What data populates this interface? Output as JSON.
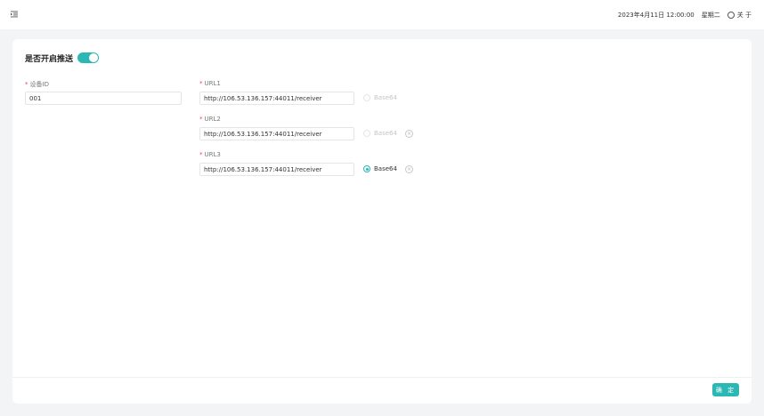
{
  "topbar": {
    "menu_icon": "menu-fold-icon",
    "datetime": "2023年4月11日 12:00:00",
    "weekday": "星期二",
    "about_label": "关 于",
    "about_icon": "info-circle-icon"
  },
  "form": {
    "title": "是否开启推送",
    "push_enabled": true,
    "device": {
      "label": "设备ID",
      "required": "*",
      "value": "001"
    },
    "urls": [
      {
        "label": "URL1",
        "required": "*",
        "value": "http://106.53.136.157:44011/receiver",
        "base64_label": "Base64",
        "base64_checked": false,
        "base64_disabled": true,
        "clearable": false
      },
      {
        "label": "URL2",
        "required": "*",
        "value": "http://106.53.136.157:44011/receiver",
        "base64_label": "Base64",
        "base64_checked": false,
        "base64_disabled": true,
        "clearable": true
      },
      {
        "label": "URL3",
        "required": "*",
        "value": "http://106.53.136.157:44011/receiver",
        "base64_label": "Base64",
        "base64_checked": true,
        "base64_disabled": false,
        "clearable": true
      }
    ],
    "clear_glyph": "×",
    "confirm_label": "确 定"
  },
  "colors": {
    "accent": "#2bb7b3",
    "required": "#e5484d",
    "background": "#f3f4f6"
  }
}
